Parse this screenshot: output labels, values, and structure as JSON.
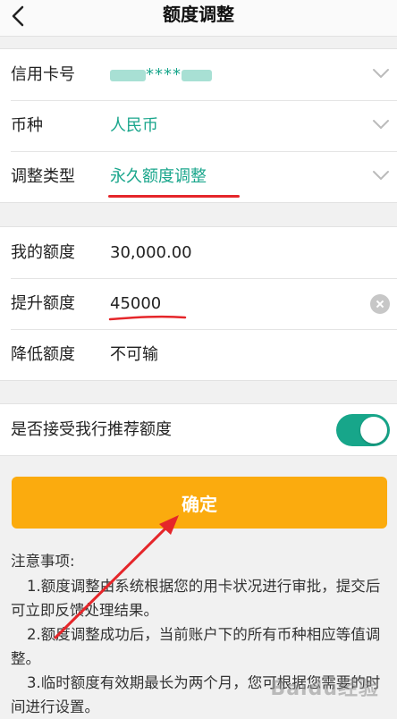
{
  "header": {
    "title": "额度调整",
    "back_icon": "chevron-left-icon"
  },
  "card_section": {
    "card_label": "信用卡号",
    "card_value_mask": "****",
    "currency_label": "币种",
    "currency_value": "人民币",
    "type_label": "调整类型",
    "type_value": "永久额度调整"
  },
  "amount_section": {
    "my_limit_label": "我的额度",
    "my_limit_value": "30,000.00",
    "increase_label": "提升额度",
    "increase_value": "45000",
    "decrease_label": "降低额度",
    "decrease_value": "不可输"
  },
  "recommend": {
    "label": "是否接受我行推荐额度",
    "toggle_on": true
  },
  "confirm_label": "确定",
  "notes": {
    "title": "注意事项:",
    "items": [
      "1.额度调整由系统根据您的用卡状况进行审批，提交后可立即反馈处理结果。",
      "2.额度调整成功后，当前账户下的所有币种相应等值调整。",
      "3.临时额度有效期最长为两个月，您可根据您需要的时间进行设置。"
    ]
  },
  "colors": {
    "accent": "#1aa68c",
    "button": "#fbab0e",
    "annotation": "#e5262a"
  },
  "watermark": "Baidu经验"
}
